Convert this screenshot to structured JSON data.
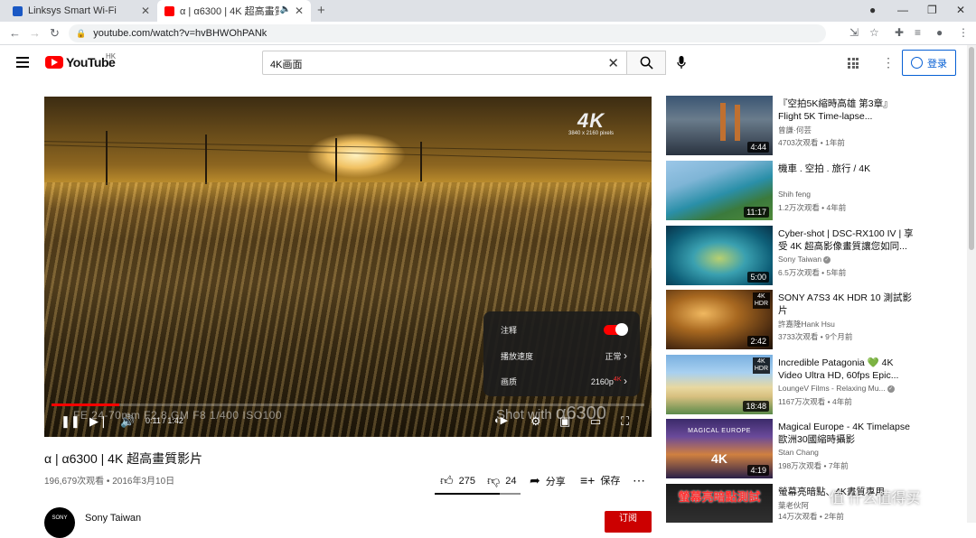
{
  "browser": {
    "tabs": [
      {
        "title": "Linksys Smart Wi-Fi",
        "active": false,
        "icon": "linksys-icon"
      },
      {
        "title": "α | α6300 | 4K 超高畫質影片",
        "active": true,
        "icon": "youtube-icon"
      }
    ],
    "url": "youtube.com/watch?v=hvBHWOhPANk"
  },
  "header": {
    "logo_text": "YouTube",
    "region": "HK",
    "search_value": "4K画面",
    "login_label": "登录"
  },
  "player": {
    "badge": "4K",
    "badge_sub": "3840 x 2160 pixels",
    "watermark": "Shot with",
    "watermark_model": "α6300",
    "camera_info": "FE 24-70mm F2.8 GM    F8 1/400 ISO100",
    "time": "0:11 / 1:42",
    "progress": 0.115,
    "settings": {
      "annotations_label": "注释",
      "speed_label": "播放速度",
      "speed_value": "正常",
      "quality_label": "画质",
      "quality_value": "2160p",
      "quality_badge": "4K"
    }
  },
  "video": {
    "title": "α | α6300 | 4K 超高畫質影片",
    "meta": "196,679次观看 • 2016年3月10日",
    "likes": "275",
    "dislikes": "24",
    "share_label": "分享",
    "save_label": "保存",
    "like_ratio": 0.76,
    "channel": "Sony Taiwan",
    "channel_avatar_text": "SONY",
    "subscribe_label": "订阅"
  },
  "recommendations": [
    {
      "title": "『空拍5K縮時高雄 第3章』Flight 5K Time-lapse...",
      "channel": "曾謙·何芸",
      "meta": "4703次观看 • 1年前",
      "duration": "4:44",
      "verified": false
    },
    {
      "title": "機車 . 空拍 . 旅行 / 4K",
      "channel": "Shih feng",
      "meta": "1.2万次观看 • 4年前",
      "duration": "11:17",
      "verified": false
    },
    {
      "title": "Cyber-shot | DSC-RX100 IV | 享受 4K 超高影像畫質讓您如同...",
      "channel": "Sony Taiwan",
      "meta": "6.5万次观看 • 5年前",
      "duration": "5:00",
      "verified": true
    },
    {
      "title": "SONY A7S3 4K HDR 10 測試影片",
      "channel": "許嘉隆Hank Hsu",
      "meta": "3733次观看 • 9个月前",
      "duration": "2:42",
      "verified": false,
      "flag": "4K\nHDR"
    },
    {
      "title": "Incredible Patagonia 💚 4K Video Ultra HD, 60fps Epic...",
      "channel": "LoungeV Films - Relaxing Mu...",
      "meta": "1167万次观看 • 4年前",
      "duration": "18:48",
      "verified": true,
      "flag": "4K\nHDR"
    },
    {
      "title": "Magical Europe - 4K Timelapse 歐洲30國縮時攝影",
      "channel": "Stan Chang",
      "meta": "198万次观看 • 7年前",
      "duration": "4:19",
      "verified": false,
      "thumb_text": "MAGICAL EUROPE",
      "thumb_big": "4K"
    },
    {
      "title": "螢幕亮暗點、4K畫質專用",
      "channel": "葉老伙阿",
      "meta": "14万次观看 • 2年前",
      "duration": "",
      "verified": false,
      "thumb_text": "螢幕亮暗點測試"
    }
  ],
  "overlay_watermark": "值 什么值得买"
}
